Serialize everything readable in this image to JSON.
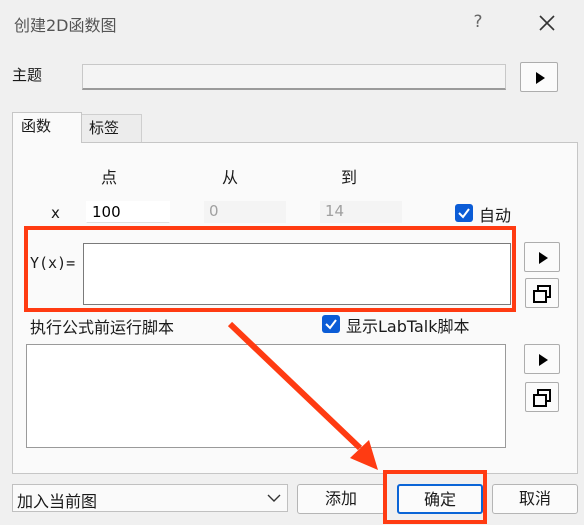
{
  "window": {
    "title": "创建2D函数图",
    "help_symbol": "?"
  },
  "subject": {
    "label": "主题",
    "value": ""
  },
  "tabs": [
    {
      "label": "函数"
    },
    {
      "label": "标签"
    }
  ],
  "range": {
    "headers": {
      "point": "点",
      "from": "从",
      "to": "到"
    },
    "x_label": "x",
    "points": "100",
    "from": "0",
    "to": "14",
    "auto_label": "自动",
    "auto_checked": true
  },
  "function": {
    "label": "Y(x)=",
    "value": ""
  },
  "script": {
    "label": "执行公式前运行脚本",
    "show_labtalk_label": "显示LabTalk脚本",
    "show_labtalk_checked": true,
    "value": ""
  },
  "footer": {
    "dropdown_value": "加入当前图",
    "add_label": "添加",
    "ok_label": "确定",
    "cancel_label": "取消"
  },
  "colors": {
    "accent": "#0b5cd6",
    "highlight_frame": "#ff3b12",
    "annotation_arrow": "#ff3b12"
  }
}
